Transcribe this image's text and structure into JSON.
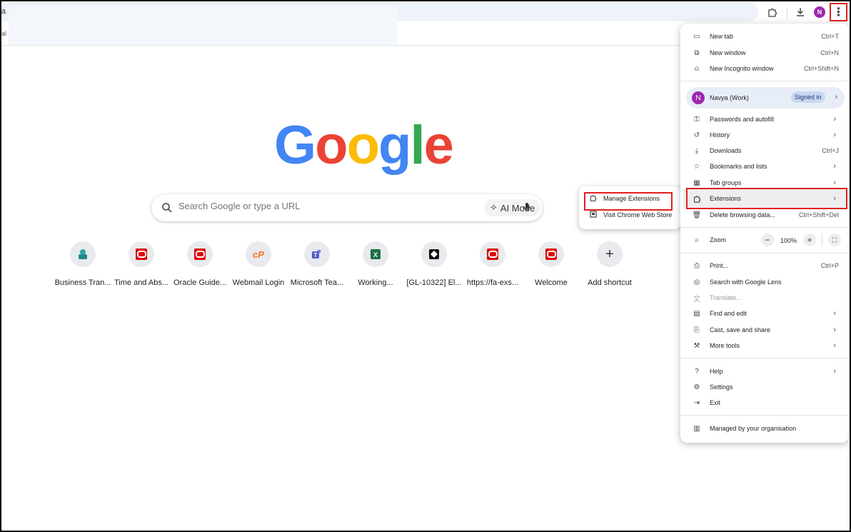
{
  "omnibox": {
    "letter": "a",
    "bookmark_letter": "al"
  },
  "toolbar": {
    "profile_initial": "N",
    "menu_glyph": "⋮"
  },
  "logo": {
    "letters": [
      "G",
      "o",
      "o",
      "g",
      "l",
      "e"
    ],
    "colors": [
      "#4285F4",
      "#EA4335",
      "#FBBC05",
      "#4285F4",
      "#34A853",
      "#EA4335"
    ]
  },
  "search": {
    "placeholder": "Search Google or type a URL",
    "ai_mode_label": "AI Mode"
  },
  "shortcuts": [
    {
      "label": "Business Tran...",
      "icon": "teams-green-icon"
    },
    {
      "label": "Time and Abs...",
      "icon": "oracle-icon"
    },
    {
      "label": "Oracle Guide...",
      "icon": "oracle-icon"
    },
    {
      "label": "Webmail Login",
      "icon": "cpanel-icon"
    },
    {
      "label": "Microsoft Tea...",
      "icon": "teams-icon"
    },
    {
      "label": "Working...",
      "icon": "excel-icon"
    },
    {
      "label": "[GL-10322] El...",
      "icon": "jira-icon"
    },
    {
      "label": "https://fa-exs...",
      "icon": "oracle-icon"
    },
    {
      "label": "Welcome",
      "icon": "oracle-icon"
    },
    {
      "label": "Add shortcut",
      "icon": "plus-icon"
    }
  ],
  "submenu": {
    "manage_extensions": "Manage Extensions",
    "visit_store": "Visit Chrome Web Store"
  },
  "menu": {
    "new_tab": {
      "label": "New tab",
      "shortcut": "Ctrl+T"
    },
    "new_window": {
      "label": "New window",
      "shortcut": "Ctrl+N"
    },
    "new_incognito": {
      "label": "New Incognito window",
      "shortcut": "Ctrl+Shift+N"
    },
    "profile": {
      "initial": "N",
      "name": "Navya (Work)",
      "status": "Signed in"
    },
    "passwords": {
      "label": "Passwords and autofill"
    },
    "history": {
      "label": "History"
    },
    "downloads": {
      "label": "Downloads",
      "shortcut": "Ctrl+J"
    },
    "bookmarks": {
      "label": "Bookmarks and lists"
    },
    "tab_groups": {
      "label": "Tab groups"
    },
    "extensions": {
      "label": "Extensions"
    },
    "delete_data": {
      "label": "Delete browsing data...",
      "shortcut": "Ctrl+Shift+Del"
    },
    "zoom": {
      "label": "Zoom",
      "value": "100%",
      "minus": "−",
      "plus": "+"
    },
    "print": {
      "label": "Print...",
      "shortcut": "Ctrl+P"
    },
    "lens": {
      "label": "Search with Google Lens"
    },
    "translate": {
      "label": "Translate..."
    },
    "find_edit": {
      "label": "Find and edit"
    },
    "cast": {
      "label": "Cast, save and share"
    },
    "more_tools": {
      "label": "More tools"
    },
    "help": {
      "label": "Help"
    },
    "settings": {
      "label": "Settings"
    },
    "exit": {
      "label": "Exit"
    },
    "managed": {
      "label": "Managed by your organisation"
    }
  },
  "colors": {
    "highlight": "#e02020",
    "profile_purple": "#9c27b0"
  }
}
